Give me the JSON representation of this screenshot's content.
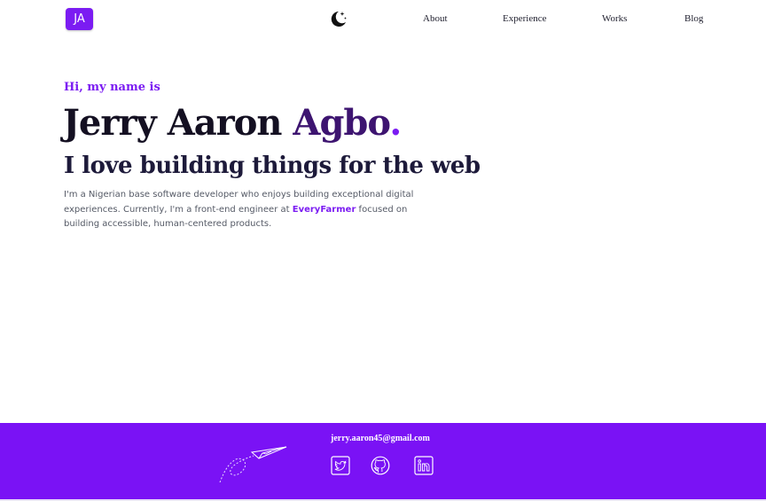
{
  "nav": {
    "logo_text": "JA",
    "links": [
      "About",
      "Experience",
      "Works",
      "Blog"
    ]
  },
  "hero": {
    "intro": "Hi, my name is",
    "name_first": "Jerry Aaron ",
    "name_last": "Agbo",
    "name_dot": ".",
    "tagline": "I love building things for the web",
    "bio_before": "I'm a Nigerian base software developer who enjoys building exceptional digital experiences. Currently, I'm a front-end engineer at ",
    "bio_link": "EveryFarmer",
    "bio_after": " focused on building accessible, human-centered products."
  },
  "footer": {
    "email": "jerry.aaron45@gmail.com",
    "social_icons": [
      "twitter-icon",
      "github-icon",
      "linkedin-icon"
    ]
  },
  "colors": {
    "accent": "#7b1cf2",
    "footer_bg": "#7a12f5",
    "heading": "#141022"
  }
}
